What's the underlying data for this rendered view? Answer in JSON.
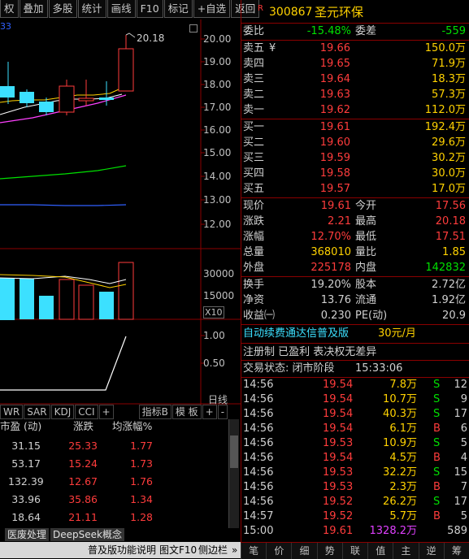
{
  "toolbar": {
    "items": [
      "权",
      "叠加",
      "多股",
      "统计",
      "画线",
      "F10",
      "标记",
      "+自选",
      "返回"
    ]
  },
  "left_axis": {
    "price_ticks": [
      "20.00",
      "19.00",
      "18.00",
      "17.00",
      "16.00",
      "15.00",
      "14.00",
      "13.00",
      "12.00"
    ],
    "high_label": "20.18",
    "vol_ticks": [
      "30000",
      "15000"
    ],
    "vol_unit": "X10",
    "ind_ticks": [
      "1.00",
      "0.50"
    ],
    "period": "日线",
    "corner_text": "33"
  },
  "indicator_tabs": [
    "WR",
    "SAR",
    "KDJ",
    "CCI",
    "+",
    "指标B",
    "模 板",
    "+",
    "-"
  ],
  "sector_table": {
    "headers": [
      "市盈 (动)",
      "涨跌",
      "均涨幅%"
    ],
    "rows": [
      [
        "31.15",
        "25.33",
        "1.77"
      ],
      [
        "53.17",
        "15.24",
        "1.73"
      ],
      [
        "132.39",
        "12.67",
        "1.76"
      ],
      [
        "33.96",
        "35.86",
        "1.34"
      ],
      [
        "18.64",
        "21.11",
        "1.28"
      ]
    ],
    "tabs": [
      "医废处理",
      "DeepSeek概念"
    ]
  },
  "status_bar": {
    "left": "普及版功能说明",
    "f10": "图文F10",
    "sidebar": "侧边栏",
    "arrows": "»"
  },
  "stock": {
    "flag": "R",
    "code": "300867",
    "name": "圣元环保"
  },
  "weibi": {
    "label": "委比",
    "value": "-15.48%",
    "label2": "委差",
    "value2": "-559"
  },
  "asks": [
    {
      "label": "卖五",
      "mark": "¥",
      "price": "19.66",
      "vol": "150.0万"
    },
    {
      "label": "卖四",
      "mark": "",
      "price": "19.65",
      "vol": "71.9万"
    },
    {
      "label": "卖三",
      "mark": "",
      "price": "19.64",
      "vol": "18.3万"
    },
    {
      "label": "卖二",
      "mark": "",
      "price": "19.63",
      "vol": "57.3万"
    },
    {
      "label": "卖一",
      "mark": "",
      "price": "19.62",
      "vol": "112.0万"
    }
  ],
  "bids": [
    {
      "label": "买一",
      "price": "19.61",
      "vol": "192.4万"
    },
    {
      "label": "买二",
      "price": "19.60",
      "vol": "29.6万"
    },
    {
      "label": "买三",
      "price": "19.59",
      "vol": "30.2万"
    },
    {
      "label": "买四",
      "price": "19.58",
      "vol": "30.0万"
    },
    {
      "label": "买五",
      "price": "19.57",
      "vol": "17.0万"
    }
  ],
  "quote": [
    {
      "l1": "现价",
      "v1": "19.61",
      "l2": "今开",
      "v2": "17.56"
    },
    {
      "l1": "涨跌",
      "v1": "2.21",
      "l2": "最高",
      "v2": "20.18"
    },
    {
      "l1": "涨幅",
      "v1": "12.70%",
      "l2": "最低",
      "v2": "17.51"
    },
    {
      "l1": "总量",
      "v1": "368010",
      "l2": "量比",
      "v2": "1.85"
    },
    {
      "l1": "外盘",
      "v1": "225178",
      "l2": "内盘",
      "v2": "142832"
    }
  ],
  "stats": [
    {
      "l1": "换手",
      "v1": "19.20%",
      "l2": "股本",
      "v2": "2.72亿"
    },
    {
      "l1": "净资",
      "v1": "13.76",
      "l2": "流通",
      "v2": "1.92亿"
    },
    {
      "l1": "收益㈠",
      "v1": "0.230",
      "l2": "PE(动)",
      "v2": "20.9"
    }
  ],
  "promo": {
    "text": "自动续费通达信普及版",
    "price": "30元/月"
  },
  "register": "注册制 已盈利 表决权无差异",
  "trade_state": {
    "label": "交易状态: 闭市阶段",
    "time": "15:33:06"
  },
  "ticks": [
    {
      "t": "14:56",
      "p": "19.54",
      "v": "7.8万",
      "s": "S",
      "n": "12"
    },
    {
      "t": "14:56",
      "p": "19.54",
      "v": "10.7万",
      "s": "S",
      "n": "9"
    },
    {
      "t": "14:56",
      "p": "19.54",
      "v": "40.3万",
      "s": "S",
      "n": "17"
    },
    {
      "t": "14:56",
      "p": "19.54",
      "v": "6.1万",
      "s": "B",
      "n": "6"
    },
    {
      "t": "14:56",
      "p": "19.53",
      "v": "10.9万",
      "s": "S",
      "n": "5"
    },
    {
      "t": "14:56",
      "p": "19.54",
      "v": "4.5万",
      "s": "B",
      "n": "4"
    },
    {
      "t": "14:56",
      "p": "19.53",
      "v": "32.2万",
      "s": "S",
      "n": "15"
    },
    {
      "t": "14:56",
      "p": "19.53",
      "v": "2.3万",
      "s": "B",
      "n": "7"
    },
    {
      "t": "14:56",
      "p": "19.52",
      "v": "26.2万",
      "s": "S",
      "n": "17"
    },
    {
      "t": "14:57",
      "p": "19.52",
      "v": "5.7万",
      "s": "B",
      "n": "5"
    },
    {
      "t": "15:00",
      "p": "19.61",
      "v": "1328.2万",
      "s": "",
      "n": "589"
    }
  ],
  "bottom_tabs": [
    "笔",
    "价",
    "细",
    "势",
    "联",
    "值",
    "主",
    "逆",
    "筹"
  ]
}
